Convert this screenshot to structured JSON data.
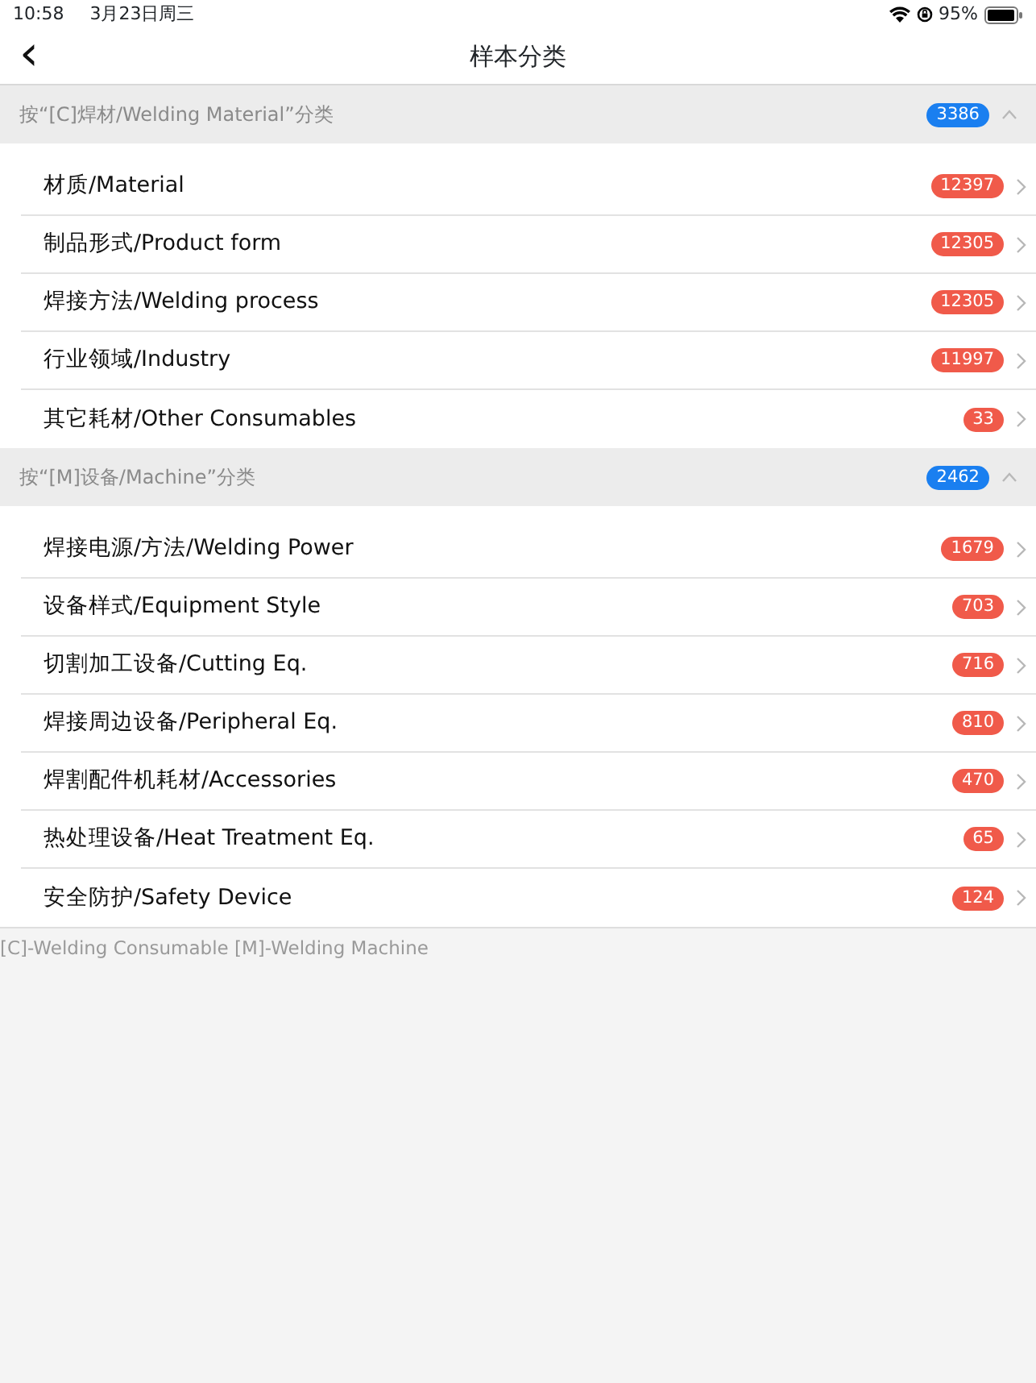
{
  "status_bar": {
    "time": "10:58",
    "date": "3月23日周三",
    "battery": "95%"
  },
  "nav": {
    "back": "‹",
    "title": "样本分类"
  },
  "sections": [
    {
      "title": "按“[C]焊材/Welding Material”分类",
      "count": "3386",
      "expanded": true,
      "items": [
        {
          "label": "材质/Material",
          "count": "12397"
        },
        {
          "label": "制品形式/Product form",
          "count": "12305"
        },
        {
          "label": "焊接方法/Welding process",
          "count": "12305"
        },
        {
          "label": "行业领域/Industry",
          "count": "11997"
        },
        {
          "label": "其它耗材/Other Consumables",
          "count": "33"
        }
      ]
    },
    {
      "title": "按“[M]设备/Machine”分类",
      "count": "2462",
      "expanded": true,
      "items": [
        {
          "label": "焊接电源/方法/Welding Power",
          "count": "1679"
        },
        {
          "label": "设备样式/Equipment Style",
          "count": "703"
        },
        {
          "label": "切割加工设备/Cutting Eq.",
          "count": "716"
        },
        {
          "label": "焊接周边设备/Peripheral Eq.",
          "count": "810"
        },
        {
          "label": "焊割配件机耗材/Accessories",
          "count": "470"
        },
        {
          "label": "热处理设备/Heat Treatment Eq.",
          "count": "65"
        },
        {
          "label": "安全防护/Safety Device",
          "count": "124"
        }
      ]
    }
  ],
  "footer": "[C]-Welding Consumable [M]-Welding Machine"
}
